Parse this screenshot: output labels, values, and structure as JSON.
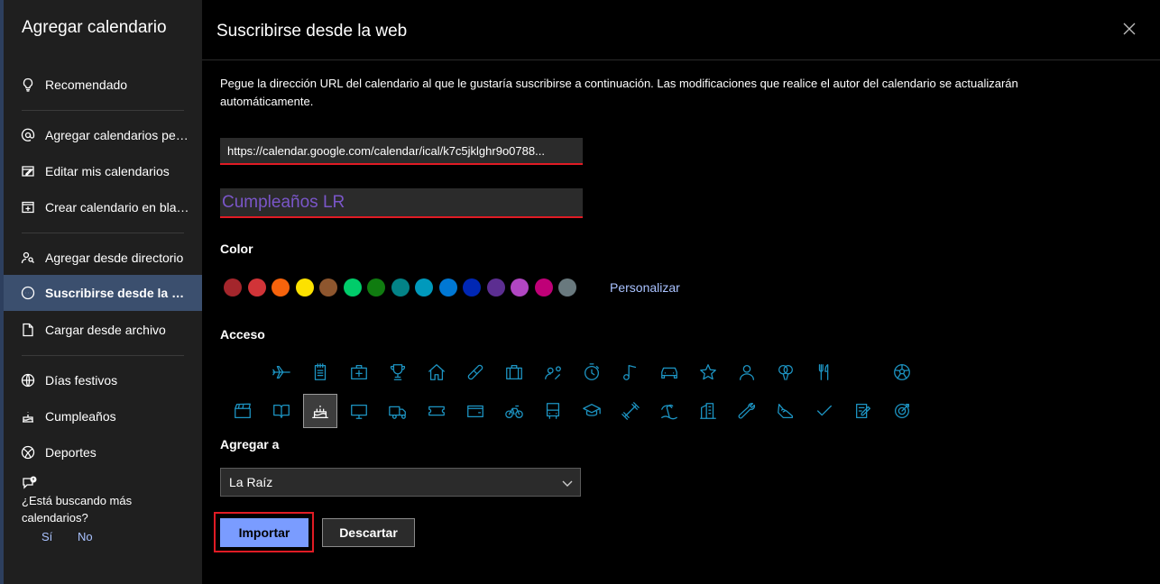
{
  "sidebar": {
    "title": "Agregar calendario",
    "items": [
      {
        "label": "Recomendado",
        "icon": "lightbulb-icon"
      },
      {
        "label": "Agregar calendarios personales",
        "icon": "at-icon"
      },
      {
        "label": "Editar mis calendarios",
        "icon": "edit-icon"
      },
      {
        "label": "Crear calendario en blanco",
        "icon": "calendar-add-icon"
      },
      {
        "label": "Agregar desde directorio",
        "icon": "people-search-icon"
      },
      {
        "label": "Suscribirse desde la web",
        "icon": "ellipsis-circle-icon",
        "active": true
      },
      {
        "label": "Cargar desde archivo",
        "icon": "file-icon"
      },
      {
        "label": "Días festivos",
        "icon": "globe-icon"
      },
      {
        "label": "Cumpleaños",
        "icon": "cake-icon"
      },
      {
        "label": "Deportes",
        "icon": "ball-icon"
      }
    ],
    "help": {
      "question": "¿Está buscando más calendarios?",
      "yes": "Sí",
      "no": "No"
    }
  },
  "main": {
    "title": "Suscribirse desde la web",
    "description": "Pegue la dirección URL del calendario al que le gustaría suscribirse a continuación. Las modificaciones que realice el autor del calendario se actualizarán automáticamente.",
    "url_value": "https://calendar.google.com/calendar/ical/k7c5jklghr9o0788...",
    "name_value": "Cumpleaños LR",
    "color_label": "Color",
    "colors": [
      "#a4262c",
      "#d13438",
      "#f7630c",
      "#fce100",
      "#8e562e",
      "#00cc6a",
      "#107c10",
      "#038387",
      "#0099bc",
      "#0078d4",
      "#0027b4",
      "#5c2e91",
      "#b146c2",
      "#bf0077",
      "#69797e"
    ],
    "customize": "Personalizar",
    "access_label": "Acceso",
    "add_to_label": "Agregar a",
    "add_to_value": "La Raíz",
    "import_button": "Importar",
    "discard_button": "Descartar"
  }
}
